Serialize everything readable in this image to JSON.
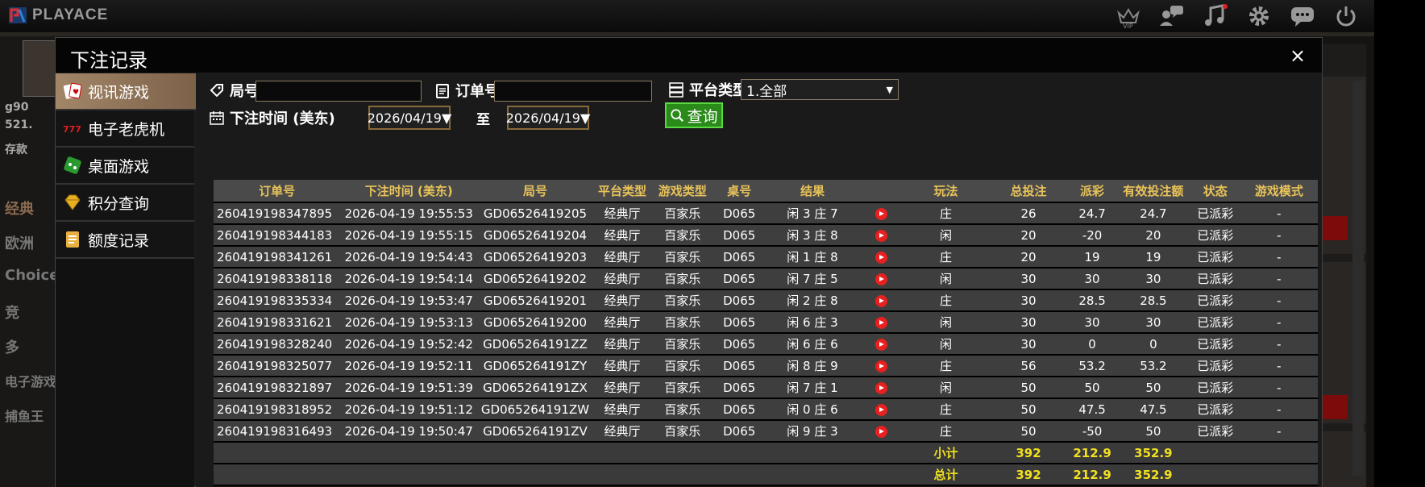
{
  "app": {
    "logo_text": "PLAYACE",
    "top_icons": [
      "vip-crown-icon",
      "chat-people-icon",
      "music-icon",
      "gear-icon",
      "message-icon",
      "power-icon"
    ],
    "vip_label": "VIP"
  },
  "background": {
    "user_id": "g90",
    "balance": "521.",
    "deposit": "存款",
    "menu": [
      "经典",
      "欧洲",
      "Choice",
      "竞",
      "多",
      "电子游戏",
      "捕鱼王"
    ]
  },
  "modal": {
    "title": "下注记录",
    "close_label": "×",
    "sidebar": [
      {
        "label": "视讯游戏",
        "icon": "cards-icon",
        "active": true
      },
      {
        "label": "电子老虎机",
        "icon": "slot-777-icon",
        "active": false
      },
      {
        "label": "桌面游戏",
        "icon": "table-game-icon",
        "active": false
      },
      {
        "label": "积分查询",
        "icon": "diamond-icon",
        "active": false
      },
      {
        "label": "额度记录",
        "icon": "document-icon",
        "active": false
      }
    ],
    "filters": {
      "round_label": "局号",
      "round_value": "",
      "order_label": "订单号",
      "order_value": "",
      "platform_label": "平台类型",
      "platform_value": "1.全部",
      "time_label": "下注时间 (美东)",
      "date_from": "2026/04/19▼",
      "to_label": "至",
      "date_to": "2026/04/19▼",
      "query_label": "查询"
    },
    "table": {
      "headers": [
        "订单号",
        "下注时间 (美东)",
        "局号",
        "平台类型",
        "游戏类型",
        "桌号",
        "结果",
        "",
        "玩法",
        "总投注",
        "派彩",
        "有效投注额",
        "状态",
        "游戏模式"
      ],
      "rows": [
        {
          "order": "260419198347895",
          "time": "2026-04-19 19:55:53",
          "round": "GD06526419205",
          "platform": "经典厅",
          "game": "百家乐",
          "table": "D065",
          "result": "闲 3 庄 7",
          "bet": "庄",
          "total": "26",
          "payout": "24.7",
          "payout_sign": "neg",
          "valid": "24.7",
          "status": "已派彩",
          "mode": "-"
        },
        {
          "order": "260419198344183",
          "time": "2026-04-19 19:55:15",
          "round": "GD06526419204",
          "platform": "经典厅",
          "game": "百家乐",
          "table": "D065",
          "result": "闲 3 庄 8",
          "bet": "闲",
          "total": "20",
          "payout": "-20",
          "payout_sign": "pos",
          "valid": "20",
          "status": "已派彩",
          "mode": "-"
        },
        {
          "order": "260419198341261",
          "time": "2026-04-19 19:54:43",
          "round": "GD06526419203",
          "platform": "经典厅",
          "game": "百家乐",
          "table": "D065",
          "result": "闲 1 庄 8",
          "bet": "庄",
          "total": "20",
          "payout": "19",
          "payout_sign": "neg",
          "valid": "19",
          "status": "已派彩",
          "mode": "-"
        },
        {
          "order": "260419198338118",
          "time": "2026-04-19 19:54:14",
          "round": "GD06526419202",
          "platform": "经典厅",
          "game": "百家乐",
          "table": "D065",
          "result": "闲 7 庄 5",
          "bet": "闲",
          "total": "30",
          "payout": "30",
          "payout_sign": "neg",
          "valid": "30",
          "status": "已派彩",
          "mode": "-"
        },
        {
          "order": "260419198335334",
          "time": "2026-04-19 19:53:47",
          "round": "GD06526419201",
          "platform": "经典厅",
          "game": "百家乐",
          "table": "D065",
          "result": "闲 2 庄 8",
          "bet": "庄",
          "total": "30",
          "payout": "28.5",
          "payout_sign": "neg",
          "valid": "28.5",
          "status": "已派彩",
          "mode": "-"
        },
        {
          "order": "260419198331621",
          "time": "2026-04-19 19:53:13",
          "round": "GD06526419200",
          "platform": "经典厅",
          "game": "百家乐",
          "table": "D065",
          "result": "闲 6 庄 3",
          "bet": "闲",
          "total": "30",
          "payout": "30",
          "payout_sign": "neg",
          "valid": "30",
          "status": "已派彩",
          "mode": "-"
        },
        {
          "order": "260419198328240",
          "time": "2026-04-19 19:52:42",
          "round": "GD065264191ZZ",
          "platform": "经典厅",
          "game": "百家乐",
          "table": "D065",
          "result": "闲 6 庄 6",
          "bet": "闲",
          "total": "30",
          "payout": "0",
          "payout_sign": "zero",
          "valid": "0",
          "status": "已派彩",
          "mode": "-"
        },
        {
          "order": "260419198325077",
          "time": "2026-04-19 19:52:11",
          "round": "GD065264191ZY",
          "platform": "经典厅",
          "game": "百家乐",
          "table": "D065",
          "result": "闲 8 庄 9",
          "bet": "庄",
          "total": "56",
          "payout": "53.2",
          "payout_sign": "neg",
          "valid": "53.2",
          "status": "已派彩",
          "mode": "-"
        },
        {
          "order": "260419198321897",
          "time": "2026-04-19 19:51:39",
          "round": "GD065264191ZX",
          "platform": "经典厅",
          "game": "百家乐",
          "table": "D065",
          "result": "闲 7 庄 1",
          "bet": "闲",
          "total": "50",
          "payout": "50",
          "payout_sign": "neg",
          "valid": "50",
          "status": "已派彩",
          "mode": "-"
        },
        {
          "order": "260419198318952",
          "time": "2026-04-19 19:51:12",
          "round": "GD065264191ZW",
          "platform": "经典厅",
          "game": "百家乐",
          "table": "D065",
          "result": "闲 0 庄 6",
          "bet": "庄",
          "total": "50",
          "payout": "47.5",
          "payout_sign": "neg",
          "valid": "47.5",
          "status": "已派彩",
          "mode": "-"
        },
        {
          "order": "260419198316493",
          "time": "2026-04-19 19:50:47",
          "round": "GD065264191ZV",
          "platform": "经典厅",
          "game": "百家乐",
          "table": "D065",
          "result": "闲 9 庄 3",
          "bet": "庄",
          "total": "50",
          "payout": "-50",
          "payout_sign": "pos",
          "valid": "50",
          "status": "已派彩",
          "mode": "-"
        }
      ],
      "subtotal": {
        "label": "小计",
        "total": "392",
        "payout": "212.9",
        "valid": "352.9"
      },
      "grandtotal": {
        "label": "总计",
        "total": "392",
        "payout": "212.9",
        "valid": "352.9"
      }
    }
  },
  "colors": {
    "header_gold": "#e8c35a",
    "payout_red": "#e03050",
    "payout_green": "#30d020",
    "active_tab": "#a38668",
    "query_green": "#2a8a1a"
  }
}
